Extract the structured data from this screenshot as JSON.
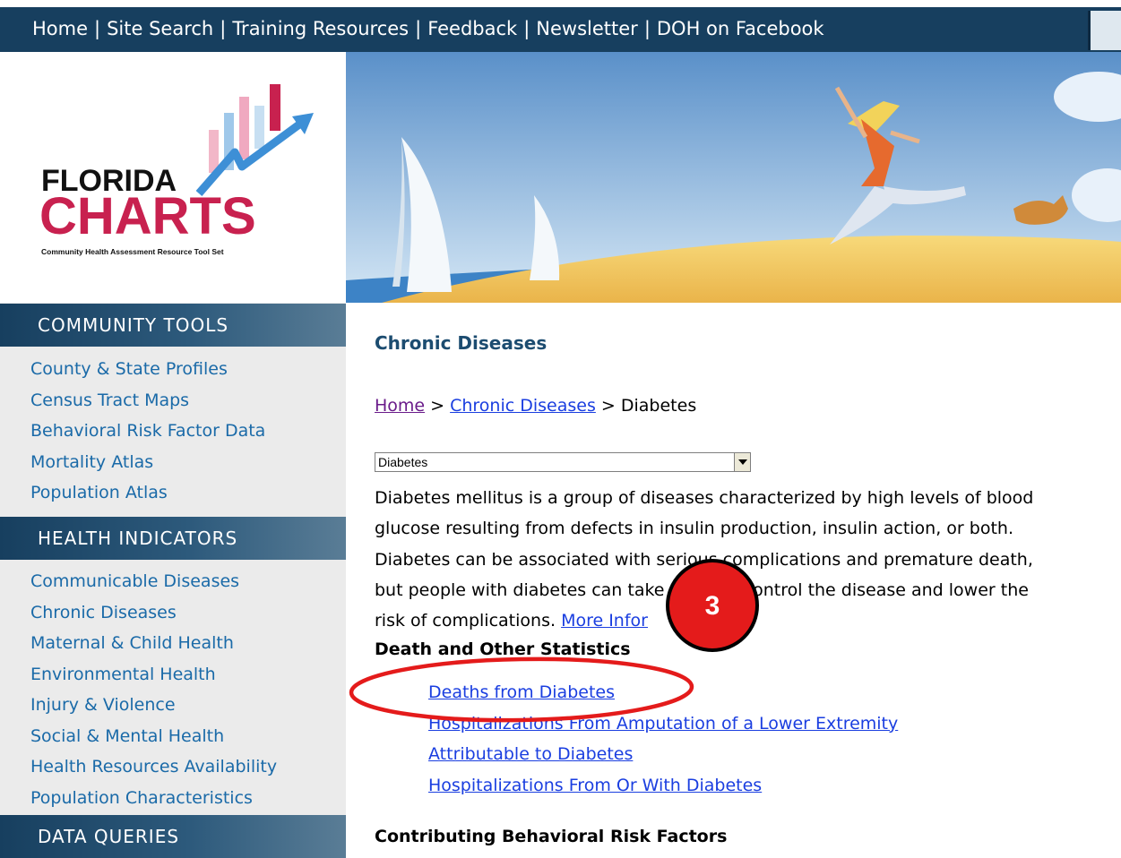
{
  "topnav": {
    "items": [
      "Home",
      "Site Search",
      "Training Resources",
      "Feedback",
      "Newsletter",
      "DOH on Facebook"
    ],
    "separator": "|"
  },
  "logo": {
    "line1": "FLORIDA",
    "line2": "CHARTS",
    "tagline": "Community Health Assessment Resource Tool Set"
  },
  "sidebar": {
    "community_tools": {
      "heading": "COMMUNITY TOOLS",
      "items": [
        "County & State Profiles",
        "Census Tract Maps",
        "Behavioral Risk Factor Data",
        "Mortality Atlas",
        "Population Atlas"
      ]
    },
    "health_indicators": {
      "heading": "HEALTH INDICATORS",
      "items": [
        "Communicable Diseases",
        "Chronic Diseases",
        "Maternal & Child Health",
        "Environmental Health",
        "Injury & Violence",
        "Social & Mental Health",
        "Health Resources Availability",
        "Population Characteristics"
      ]
    },
    "data_queries": {
      "heading": "DATA QUERIES"
    }
  },
  "content": {
    "section_title": "Chronic Diseases",
    "breadcrumb": {
      "home": "Home",
      "sep": " > ",
      "parent": "Chronic Diseases",
      "current": "Diabetes"
    },
    "dropdown": {
      "selected": "Diabetes"
    },
    "description_lines": [
      "Diabetes mellitus is a group of diseases characterized by high levels of blood",
      "glucose resulting from defects in insulin production, insulin action, or both.",
      "Diabetes can be associated with serious complications and premature death,",
      "but people with diabetes can take steps to control the disease and lower the"
    ],
    "description_last": "risk of complications.",
    "more_info": "More Infor",
    "death_heading": "Death and Other Statistics",
    "stat_links": [
      "Deaths from Diabetes",
      "Hospitalizations From Amputation of a Lower Extremity",
      "Attributable to Diabetes",
      "Hospitalizations From Or With Diabetes"
    ],
    "behavior_heading": "Contributing Behavioral Risk Factors"
  },
  "annotation": {
    "step_number": "3"
  },
  "colors": {
    "nav_bg": "#173f5f",
    "sidebar_link": "#1a6aa8",
    "content_link": "#1a3ee0",
    "logo_red": "#c8214f",
    "annotation_red": "#e41b1b"
  }
}
